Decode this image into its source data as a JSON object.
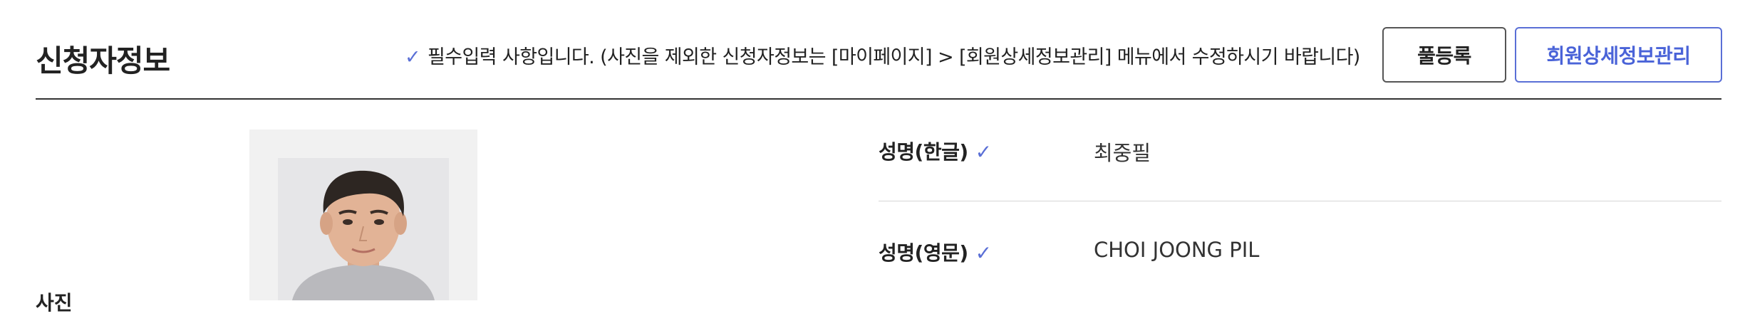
{
  "section": {
    "title": "신청자정보"
  },
  "notice": {
    "text": "필수입력 사항입니다. (사진을 제외한 신청자정보는 [마이페이지] > [회원상세정보관리] 메뉴에서 수정하시기 바랍니다)"
  },
  "buttons": {
    "register_label": "풀등록",
    "member_detail_label": "회원상세정보관리"
  },
  "photo": {
    "label": "사진"
  },
  "fields": [
    {
      "label": "성명(한글)",
      "value": "최중필"
    },
    {
      "label": "성명(영문)",
      "value": "CHOI JOONG PIL"
    }
  ],
  "colors": {
    "accent": "#5a6fd6",
    "text": "#222222",
    "divider": "#333333"
  }
}
